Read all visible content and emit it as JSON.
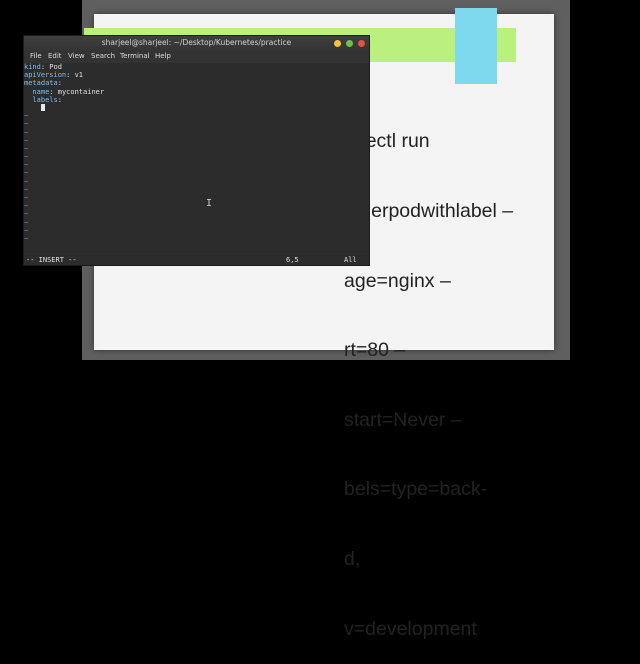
{
  "slide": {
    "lines": [
      "ubectl run",
      "otherpodwithlabel –",
      "age=nginx –",
      "rt=80 –",
      "start=Never –",
      "bels=type=back-",
      "d,",
      "v=development"
    ]
  },
  "terminal": {
    "title": "sharjeel@sharjeel: ~/Desktop/Kubernetes/practice",
    "menu": [
      "File",
      "Edit",
      "View",
      "Search",
      "Terminal",
      "Help"
    ],
    "lines": [
      {
        "key": "kind",
        "value": " Pod"
      },
      {
        "key": "apiVersion",
        "value": " v1"
      },
      {
        "key": "metadata",
        "value": ""
      },
      {
        "key": "  name",
        "value": " mycontainer"
      },
      {
        "key": "  labels",
        "value": ""
      }
    ],
    "status": {
      "mode": "-- INSERT --",
      "position": "6,5",
      "scroll": "All"
    },
    "colors": {
      "close": "#e5533c",
      "maximize": "#f2c33c",
      "minimize": "#6cc24a"
    }
  }
}
